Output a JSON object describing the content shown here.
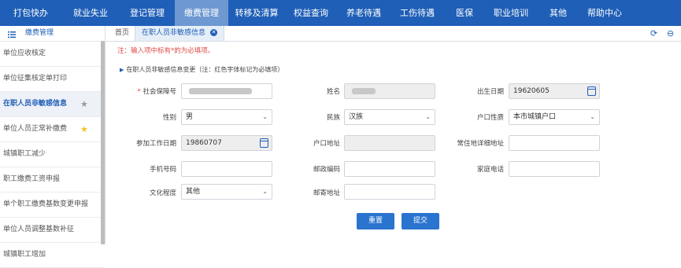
{
  "topnav": {
    "items": [
      "打包快办",
      "就业失业",
      "登记管理",
      "缴费管理",
      "转移及清算",
      "权益查询",
      "养老待遇",
      "工伤待遇",
      "医保",
      "职业培训",
      "其他",
      "帮助中心"
    ],
    "active_index": 3
  },
  "sidebar": {
    "title": "缴费管理",
    "items": [
      {
        "label": "单位应收核定"
      },
      {
        "label": "单位征集核定单打印"
      },
      {
        "label": "在职人员非敏感信息"
      },
      {
        "label": "单位人员正常补缴费"
      },
      {
        "label": "城镇职工减少"
      },
      {
        "label": "职工缴费工资申报"
      },
      {
        "label": "单个职工缴费基数变更申报"
      },
      {
        "label": "单位人员调整基数补征"
      },
      {
        "label": "城镇职工增加"
      }
    ]
  },
  "tabs": {
    "home": "首页",
    "active": "在职人员非敏感信息"
  },
  "form": {
    "note": "注：输入项中标有*的为必填项。",
    "section_title": "在职人员非敏感信息变更（注：红色字体标记为必填项）",
    "required_mark": "*",
    "labels": {
      "ssn": "社会保障号",
      "name": "姓名",
      "birth": "出生日期",
      "gender": "性别",
      "ethnicity": "民族",
      "hukou_type": "户口性质",
      "work_start": "参加工作日期",
      "hukou_addr": "户口地址",
      "residence": "常住地详细地址",
      "mobile": "手机号码",
      "postcode": "邮政编码",
      "home_phone": "家庭电话",
      "education": "文化程度",
      "mail_addr": "邮寄地址"
    },
    "values": {
      "birth": "19620605",
      "gender": "男",
      "ethnicity": "汉族",
      "hukou_type": "本市城镇户口",
      "work_start": "19860707",
      "education": "其他"
    }
  },
  "buttons": {
    "reset": "重置",
    "submit": "提交"
  },
  "colors": {
    "nav": "#1f5fb7",
    "nav_active": "#6e98d2",
    "required": "#e14a4a",
    "button": "#2a73cf"
  }
}
